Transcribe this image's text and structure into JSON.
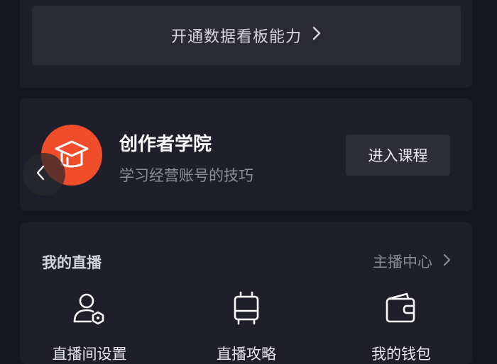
{
  "dashboard": {
    "open_label": "开通数据看板能力"
  },
  "academy": {
    "title": "创作者学院",
    "subtitle": "学习经营账号的技巧",
    "enter_label": "进入课程"
  },
  "live": {
    "title": "我的直播",
    "center_link": "主播中心",
    "items": [
      {
        "label": "直播间设置",
        "icon": "user-settings-icon"
      },
      {
        "label": "直播攻略",
        "icon": "luggage-icon"
      },
      {
        "label": "我的钱包",
        "icon": "wallet-icon"
      }
    ]
  },
  "colors": {
    "background": "#161620",
    "card": "#1f1f2b",
    "button": "#2a2a37",
    "academy_logo": "#f04e2a"
  }
}
